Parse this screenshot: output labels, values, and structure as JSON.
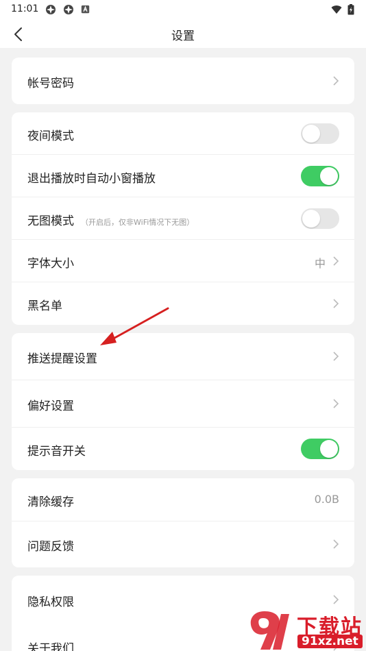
{
  "status_bar": {
    "time": "11:01"
  },
  "header": {
    "title": "设置"
  },
  "groups": [
    {
      "items": [
        {
          "label": "帐号密码",
          "control": "chevron"
        }
      ]
    },
    {
      "items": [
        {
          "label": "夜间模式",
          "control": "toggle",
          "on": false
        },
        {
          "label": "退出播放时自动小窗播放",
          "control": "toggle",
          "on": true
        },
        {
          "label": "无图模式",
          "hint": "（开启后，仅非WiFi情况下无图）",
          "control": "toggle",
          "on": false
        },
        {
          "label": "字体大小",
          "value": "中",
          "control": "chevron"
        },
        {
          "label": "黑名单",
          "control": "chevron"
        }
      ]
    },
    {
      "items": [
        {
          "label": "推送提醒设置",
          "control": "chevron"
        },
        {
          "label": "偏好设置",
          "control": "chevron"
        },
        {
          "label": "提示音开关",
          "control": "toggle",
          "on": true
        }
      ]
    },
    {
      "items": [
        {
          "label": "清除缓存",
          "value": "0.0B"
        },
        {
          "label": "问题反馈",
          "control": "chevron"
        }
      ]
    },
    {
      "items": [
        {
          "label": "隐私权限",
          "control": "chevron"
        },
        {
          "label": "关于我们",
          "control": "chevron"
        }
      ]
    }
  ],
  "watermark": {
    "line1": "下载站",
    "line2": "91xz.net"
  },
  "colors": {
    "toggle_on": "#3fcc63",
    "toggle_off": "#e6e6e6",
    "annotation_arrow": "#d62020",
    "background": "#f2f2f2"
  }
}
